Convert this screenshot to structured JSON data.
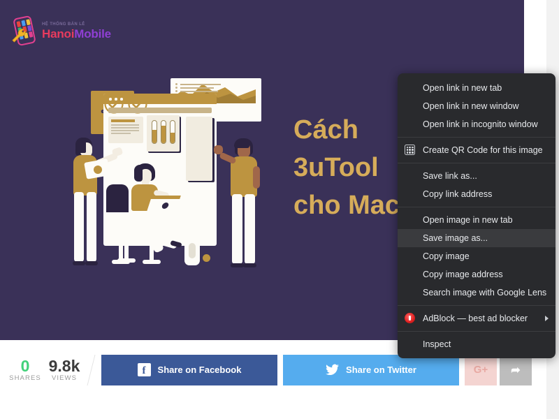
{
  "site": {
    "logo_tagline": "HỆ THỐNG BÁN LẺ",
    "logo_name_a": "Hanoi",
    "logo_name_b": "Mobile",
    "logo_icon": "phone-wrench-icon"
  },
  "hero": {
    "title_lines": [
      "Cách",
      "3uTool",
      "cho Mac"
    ],
    "background_color": "#3a3158",
    "title_color": "#d6ac5a",
    "illustration_name": "team-analytics-illustration",
    "code_badge_text": "</>"
  },
  "share_bar": {
    "shares": {
      "value": "0",
      "label": "SHARES",
      "color": "#42d17a"
    },
    "views": {
      "value": "9.8k",
      "label": "VIEWS",
      "color": "#3c3c3c"
    },
    "buttons": [
      {
        "name": "facebook",
        "label": "Share on Facebook",
        "icon": "facebook-icon",
        "color": "#3b5998"
      },
      {
        "name": "twitter",
        "label": "Share on Twitter",
        "icon": "twitter-icon",
        "color": "#55acee"
      },
      {
        "name": "googleplus",
        "label": "G+",
        "icon": "google-plus-icon",
        "color": "#f4d4d1"
      },
      {
        "name": "more",
        "label": "➦",
        "icon": "share-arrow-icon",
        "color": "#bdbdbd"
      }
    ]
  },
  "context_menu": {
    "background_color": "#292a2d",
    "highlight_color": "#3a3b3e",
    "groups": [
      {
        "items": [
          {
            "label": "Open link in new tab",
            "icon": null,
            "highlighted": false,
            "submenu": false
          },
          {
            "label": "Open link in new window",
            "icon": null,
            "highlighted": false,
            "submenu": false
          },
          {
            "label": "Open link in incognito window",
            "icon": null,
            "highlighted": false,
            "submenu": false
          }
        ]
      },
      {
        "items": [
          {
            "label": "Create QR Code for this image",
            "icon": "qr-code-icon",
            "highlighted": false,
            "submenu": false
          }
        ]
      },
      {
        "items": [
          {
            "label": "Save link as...",
            "icon": null,
            "highlighted": false,
            "submenu": false
          },
          {
            "label": "Copy link address",
            "icon": null,
            "highlighted": false,
            "submenu": false
          }
        ]
      },
      {
        "items": [
          {
            "label": "Open image in new tab",
            "icon": null,
            "highlighted": false,
            "submenu": false
          },
          {
            "label": "Save image as...",
            "icon": null,
            "highlighted": true,
            "submenu": false
          },
          {
            "label": "Copy image",
            "icon": null,
            "highlighted": false,
            "submenu": false
          },
          {
            "label": "Copy image address",
            "icon": null,
            "highlighted": false,
            "submenu": false
          },
          {
            "label": "Search image with Google Lens",
            "icon": null,
            "highlighted": false,
            "submenu": false
          }
        ]
      },
      {
        "items": [
          {
            "label": "AdBlock — best ad blocker",
            "icon": "adblock-icon",
            "highlighted": false,
            "submenu": true
          }
        ]
      },
      {
        "items": [
          {
            "label": "Inspect",
            "icon": null,
            "highlighted": false,
            "submenu": false
          }
        ]
      }
    ]
  }
}
